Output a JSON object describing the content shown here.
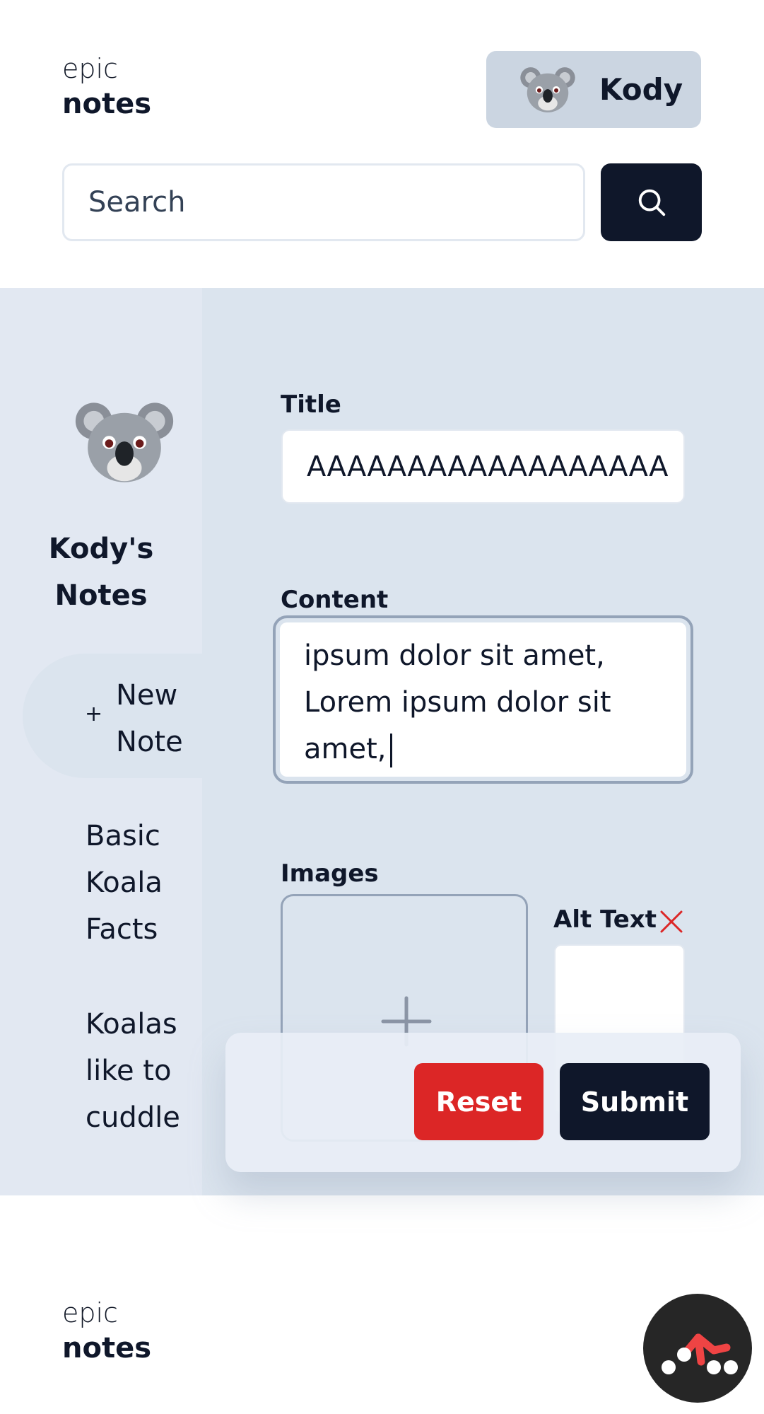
{
  "header": {
    "logo_line1": "epic",
    "logo_line2": "notes",
    "user_name": "Kody",
    "search_placeholder": "Search"
  },
  "sidebar": {
    "owner_title": "Kody's Notes",
    "new_note_label": "New Note",
    "notes": [
      "Basic Koala Facts",
      "Koalas like to cuddle"
    ]
  },
  "form": {
    "title_label": "Title",
    "title_value": "AAAAAAAAAAAAAAAAAA",
    "content_label": "Content",
    "content_value": "amet, Lorem ipsum dolor sit amet, Lorem ipsum dolor sit amet, Lorem ipsum dolor sit amet,",
    "images_label": "Images",
    "alt_text_label": "Alt Text",
    "alt_text_value": "",
    "reset_label": "Reset",
    "submit_label": "Submit"
  },
  "footer": {
    "logo_line1": "epic",
    "logo_line2": "notes"
  },
  "colors": {
    "primary": "#0f172a",
    "destructive": "#dc2626",
    "muted": "#cbd5e1",
    "panel": "#dbe4ee"
  },
  "icons": {
    "search": "magnifier-icon",
    "add": "plus-icon",
    "remove": "close-x-icon",
    "help": "remix-logo-icon"
  }
}
